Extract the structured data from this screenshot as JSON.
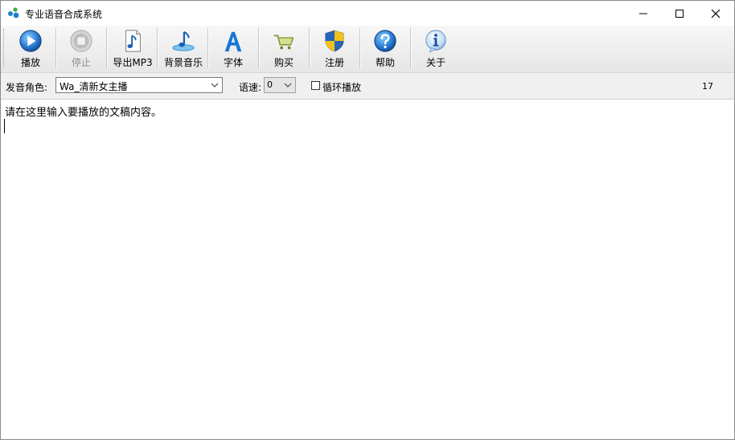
{
  "window": {
    "title": "专业语音合成系统"
  },
  "toolbar": {
    "buttons": [
      {
        "label": "播放",
        "icon": "play-icon",
        "enabled": true
      },
      {
        "label": "停止",
        "icon": "stop-icon",
        "enabled": false
      },
      {
        "label": "导出MP3",
        "icon": "music-note-icon",
        "enabled": true
      },
      {
        "label": "背景音乐",
        "icon": "music-disc-icon",
        "enabled": true
      },
      {
        "label": "字体",
        "icon": "font-icon",
        "enabled": true
      },
      {
        "label": "购买",
        "icon": "cart-icon",
        "enabled": true
      },
      {
        "label": "注册",
        "icon": "shield-icon",
        "enabled": true
      },
      {
        "label": "帮助",
        "icon": "help-icon",
        "enabled": true
      },
      {
        "label": "关于",
        "icon": "info-icon",
        "enabled": true
      }
    ]
  },
  "options": {
    "voice_label": "发音角色:",
    "voice_value": "Wa_清新女主播",
    "speed_label": "语速:",
    "speed_value": "0",
    "loop_label": "循环播放",
    "loop_checked": false,
    "count": "17"
  },
  "editor": {
    "text": "请在这里输入要播放的文稿内容。"
  },
  "colors": {
    "accent_blue": "#1a5fb4",
    "toolbar_bg": "#ececec"
  }
}
